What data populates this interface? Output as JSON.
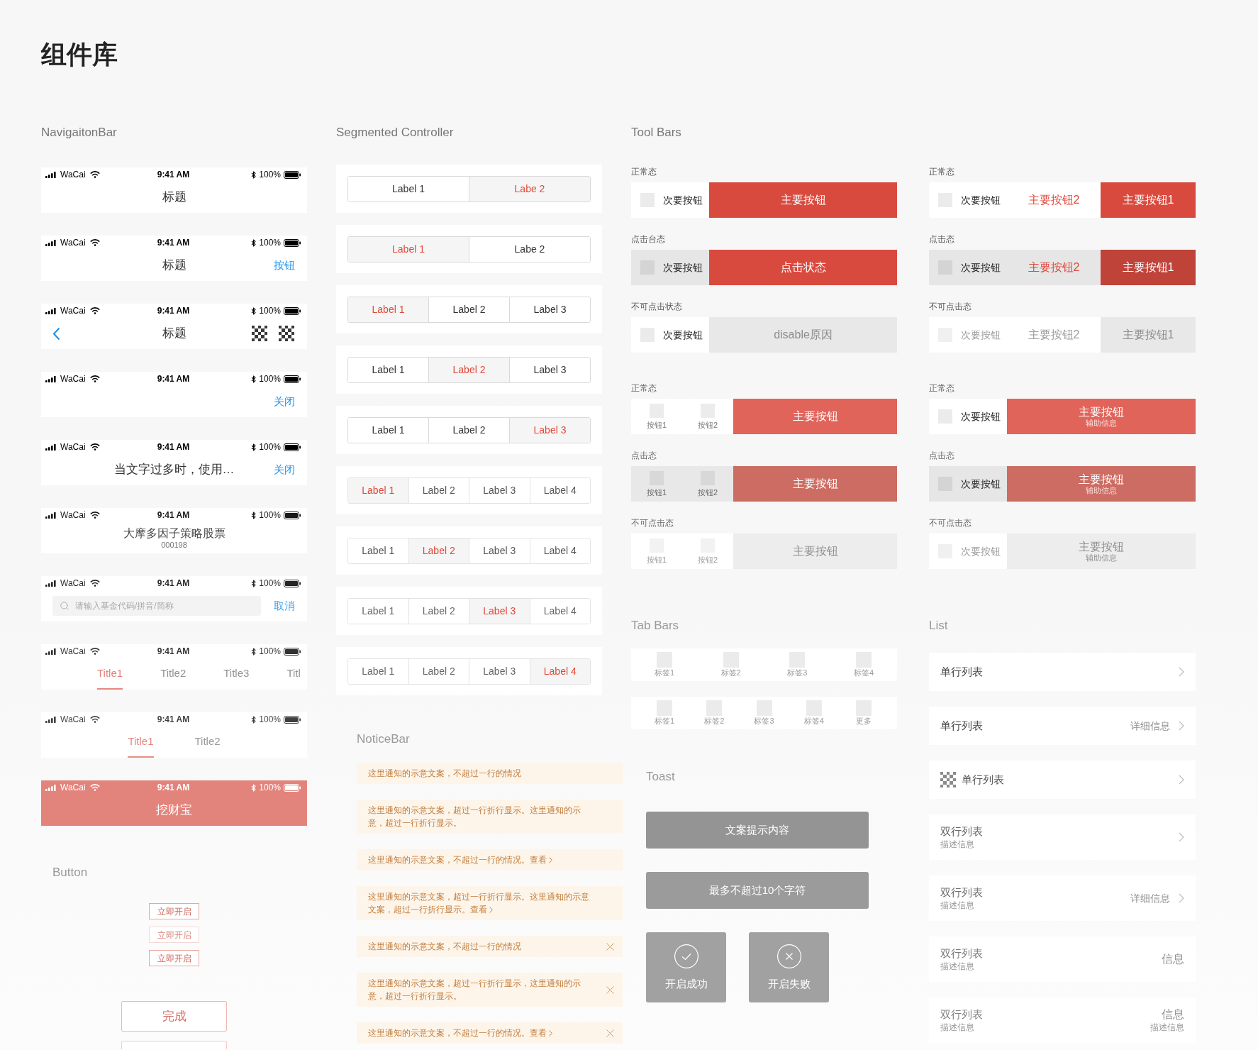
{
  "page_title": "组件库",
  "navigation_bar": {
    "heading": "NavigaitonBar",
    "bars": [
      {
        "kind": "title",
        "highlighted": false,
        "status": {
          "carrier": "WaCai",
          "time": "9:41 AM",
          "battery": "100%"
        },
        "title": "标题"
      },
      {
        "kind": "title_action",
        "highlighted": false,
        "status": {
          "carrier": "WaCai",
          "time": "9:41 AM",
          "battery": "100%"
        },
        "title": "标题",
        "action": "按钮"
      },
      {
        "kind": "back_icons",
        "highlighted": false,
        "status": {
          "carrier": "WaCai",
          "time": "9:41 AM",
          "battery": "100%"
        },
        "title": "标题"
      },
      {
        "kind": "action_only",
        "highlighted": false,
        "status": {
          "carrier": "WaCai",
          "time": "9:41 AM",
          "battery": "100%"
        },
        "action": "关闭"
      },
      {
        "kind": "title_action",
        "highlighted": false,
        "status": {
          "carrier": "WaCai",
          "time": "9:41 AM",
          "battery": "100%"
        },
        "title": "当文字过多时，使用…",
        "action": "关闭"
      },
      {
        "kind": "title_subtitle",
        "highlighted": false,
        "status": {
          "carrier": "WaCai",
          "time": "9:41 AM",
          "battery": "100%"
        },
        "title": "大摩多因子策略股票",
        "subtitle": "000198"
      },
      {
        "kind": "search",
        "highlighted": false,
        "status": {
          "carrier": "WaCai",
          "time": "9:41 AM",
          "battery": "100%"
        },
        "placeholder": "请输入基金代码/拼音/简称",
        "action": "取消"
      },
      {
        "kind": "tabs_scroll",
        "highlighted": false,
        "status": {
          "carrier": "WaCai",
          "time": "9:41 AM",
          "battery": "100%"
        },
        "tabs": [
          {
            "label": "Title1",
            "selected": true
          },
          {
            "label": "Title2",
            "selected": false
          },
          {
            "label": "Title3",
            "selected": false
          },
          {
            "label": "Titl",
            "selected": false
          }
        ]
      },
      {
        "kind": "tabs",
        "highlighted": false,
        "status": {
          "carrier": "WaCai",
          "time": "9:41 AM",
          "battery": "100%"
        },
        "tabs": [
          {
            "label": "Title1",
            "selected": true
          },
          {
            "label": "Title2",
            "selected": false
          }
        ]
      },
      {
        "kind": "title",
        "highlighted": true,
        "status": {
          "carrier": "WaCai",
          "time": "9:41 AM",
          "battery": "100%"
        },
        "title": "挖财宝"
      }
    ]
  },
  "button": {
    "heading": "Button",
    "buttons": [
      {
        "kind": "small",
        "label": "立即开启",
        "disabled": false
      },
      {
        "kind": "small",
        "label": "立即开启",
        "disabled": true
      },
      {
        "kind": "small",
        "label": "立即开启",
        "disabled": false
      },
      {
        "kind": "large",
        "label": "完成",
        "disabled": false
      },
      {
        "kind": "large"
      }
    ]
  },
  "segmented_controller": {
    "heading": "Segmented Controller",
    "controls": [
      {
        "segments": [
          {
            "label": "Label 1",
            "selected": false
          },
          {
            "label": "Labe 2",
            "selected": true
          }
        ]
      },
      {
        "segments": [
          {
            "label": "Label 1",
            "selected": true
          },
          {
            "label": "Labe 2",
            "selected": false
          }
        ]
      },
      {
        "segments": [
          {
            "label": "Label 1",
            "selected": true
          },
          {
            "label": "Label 2",
            "selected": false
          },
          {
            "label": "Label 3",
            "selected": false
          }
        ]
      },
      {
        "segments": [
          {
            "label": "Label 1",
            "selected": false
          },
          {
            "label": "Label 2",
            "selected": true
          },
          {
            "label": "Label 3",
            "selected": false
          }
        ]
      },
      {
        "segments": [
          {
            "label": "Label 1",
            "selected": false
          },
          {
            "label": "Label 2",
            "selected": false
          },
          {
            "label": "Label 3",
            "selected": true
          }
        ]
      },
      {
        "segments": [
          {
            "label": "Label 1",
            "selected": true
          },
          {
            "label": "Label 2",
            "selected": false
          },
          {
            "label": "Label 3",
            "selected": false
          },
          {
            "label": "Label 4",
            "selected": false
          }
        ]
      },
      {
        "segments": [
          {
            "label": "Label 1",
            "selected": false
          },
          {
            "label": "Label 2",
            "selected": true
          },
          {
            "label": "Label 3",
            "selected": false
          },
          {
            "label": "Label 4",
            "selected": false
          }
        ]
      },
      {
        "segments": [
          {
            "label": "Label 1",
            "selected": false
          },
          {
            "label": "Label 2",
            "selected": false
          },
          {
            "label": "Label 3",
            "selected": true
          },
          {
            "label": "Label 4",
            "selected": false
          }
        ]
      },
      {
        "segments": [
          {
            "label": "Label 1",
            "selected": false
          },
          {
            "label": "Label 2",
            "selected": false
          },
          {
            "label": "Label 3",
            "selected": false
          },
          {
            "label": "Label 4",
            "selected": true
          }
        ]
      }
    ]
  },
  "notice_bar": {
    "heading": "NoticeBar",
    "notices": [
      {
        "kind": "plain",
        "text": "这里通知的示意文案，不超过一行的情况"
      },
      {
        "kind": "plain",
        "text": "这里通知的示意文案，超过一行折行显示。这里通知的示意，超过一行折行显示。"
      },
      {
        "kind": "plain",
        "text": "这里通知的示意文案，不超过一行的情况。",
        "link": "查看"
      },
      {
        "kind": "plain",
        "text": "这里通知的示意文案，超过一行折行显示。这里通知的示意文案，超过一行折行显示。",
        "link": "查看"
      },
      {
        "kind": "closable",
        "text": "这里通知的示意文案，不超过一行的情况"
      },
      {
        "kind": "closable",
        "text": "这里通知的示意文案，超过一行折行显示，这里通知的示意，超过一行折行显示。"
      },
      {
        "kind": "closable",
        "text": "这里通知的示意文案，不超过一行的情况。",
        "link": "查看"
      }
    ]
  },
  "tool_bars": {
    "heading": "Tool Bars",
    "groups": [
      {
        "toolbars": [
          {
            "caption": "正常态",
            "buttons": [
              {
                "kind": "secondary",
                "label": "次要按钮",
                "pressed": false,
                "disabled": false
              },
              {
                "kind": "primary",
                "label": "主要按钮",
                "pressed": false,
                "disabled": false
              }
            ]
          },
          {
            "caption": "点击台态",
            "buttons": [
              {
                "kind": "secondary",
                "label": "次要按钮",
                "pressed": true,
                "disabled": false
              },
              {
                "kind": "primary",
                "label": "点击状态",
                "pressed": false,
                "disabled": false
              }
            ]
          },
          {
            "caption": "不可点击状态",
            "buttons": [
              {
                "kind": "secondary",
                "label": "次要按钮",
                "pressed": false,
                "disabled": false
              },
              {
                "kind": "primary",
                "label": "disable原因",
                "pressed": false,
                "disabled": true
              }
            ]
          }
        ]
      },
      {
        "toolbars": [
          {
            "caption": "正常态",
            "buttons": [
              {
                "kind": "secondary",
                "label": "次要按钮",
                "pressed": false,
                "disabled": false
              },
              {
                "kind": "outline",
                "label": "主要按钮2",
                "pressed": false,
                "disabled": false
              },
              {
                "kind": "primary",
                "label": "主要按钮1",
                "pressed": false,
                "disabled": false
              }
            ]
          },
          {
            "caption": "点击态",
            "buttons": [
              {
                "kind": "secondary",
                "label": "次要按钮",
                "pressed": true,
                "disabled": false
              },
              {
                "kind": "outline",
                "label": "主要按钮2",
                "pressed": true,
                "disabled": false
              },
              {
                "kind": "primary",
                "label": "主要按钮1",
                "pressed": true,
                "disabled": false
              }
            ]
          },
          {
            "caption": "不可点击态",
            "buttons": [
              {
                "kind": "secondary",
                "label": "次要按钮",
                "pressed": false,
                "disabled": true
              },
              {
                "kind": "outline",
                "label": "主要按钮2",
                "pressed": false,
                "disabled": true
              },
              {
                "kind": "primary",
                "label": "主要按钮1",
                "pressed": false,
                "disabled": true
              }
            ]
          }
        ]
      },
      {
        "toolbars": [
          {
            "caption": "正常态",
            "buttons": [
              {
                "kind": "icon",
                "label": "按钮1",
                "pressed": false,
                "disabled": false
              },
              {
                "kind": "icon",
                "label": "按钮2",
                "pressed": false,
                "disabled": false
              },
              {
                "kind": "primary",
                "label": "主要按钮",
                "pressed": false,
                "disabled": false
              }
            ]
          },
          {
            "caption": "点击态",
            "buttons": [
              {
                "kind": "icon",
                "label": "按钮1",
                "pressed": true,
                "disabled": false
              },
              {
                "kind": "icon",
                "label": "按钮2",
                "pressed": true,
                "disabled": false
              },
              {
                "kind": "primary",
                "label": "主要按钮",
                "pressed": true,
                "disabled": false
              }
            ]
          },
          {
            "caption": "不可点击态",
            "buttons": [
              {
                "kind": "icon",
                "label": "按钮1",
                "pressed": false,
                "disabled": true
              },
              {
                "kind": "icon",
                "label": "按钮2",
                "pressed": false,
                "disabled": true
              },
              {
                "kind": "primary",
                "label": "主要按钮",
                "pressed": false,
                "disabled": true
              }
            ]
          }
        ]
      },
      {
        "toolbars": [
          {
            "caption": "正常态",
            "buttons": [
              {
                "kind": "secondary",
                "label": "次要按钮",
                "pressed": false,
                "disabled": false
              },
              {
                "kind": "primary",
                "label": "主要按钮",
                "subtitle": "辅助信息",
                "pressed": false,
                "disabled": false
              }
            ]
          },
          {
            "caption": "点击态",
            "buttons": [
              {
                "kind": "secondary",
                "label": "次要按钮",
                "pressed": true,
                "disabled": false
              },
              {
                "kind": "primary",
                "label": "主要按钮",
                "subtitle": "辅助信息",
                "pressed": true,
                "disabled": false
              }
            ]
          },
          {
            "caption": "不可点击态",
            "buttons": [
              {
                "kind": "secondary",
                "label": "次要按钮",
                "pressed": false,
                "disabled": true
              },
              {
                "kind": "primary",
                "label": "主要按钮",
                "subtitle": "辅助信息",
                "pressed": false,
                "disabled": true
              }
            ]
          }
        ]
      }
    ]
  },
  "tab_bars": {
    "heading": "Tab Bars",
    "bars": [
      {
        "items": [
          "标签1",
          "标签2",
          "标签3",
          "标签4"
        ]
      },
      {
        "items": [
          "标签1",
          "标签2",
          "标签3",
          "标签4",
          "更多"
        ]
      }
    ]
  },
  "toast": {
    "heading": "Toast",
    "toasts": [
      {
        "kind": "text",
        "text": "文案提示内容"
      },
      {
        "kind": "text",
        "text": "最多不超过10个字符"
      },
      {
        "kind": "success",
        "text": "开启成功"
      },
      {
        "kind": "failure",
        "text": "开启失败"
      }
    ]
  },
  "list": {
    "heading": "List",
    "rows": [
      {
        "kind": "single",
        "title": "单行列表",
        "arrow": true
      },
      {
        "kind": "single",
        "title": "单行列表",
        "detail": "详细信息",
        "arrow": true
      },
      {
        "kind": "single_icon",
        "title": "单行列表",
        "arrow": true
      },
      {
        "kind": "double",
        "title": "双行列表",
        "description": "描述信息",
        "arrow": true
      },
      {
        "kind": "double",
        "title": "双行列表",
        "description": "描述信息",
        "detail": "详细信息",
        "arrow": true
      },
      {
        "kind": "double",
        "title": "双行列表",
        "description": "描述信息",
        "detail": "信息",
        "arrow": false
      },
      {
        "kind": "double",
        "title": "双行列表",
        "description": "描述信息",
        "detail": "信息",
        "detail_description": "描述信息",
        "arrow": false
      }
    ]
  }
}
